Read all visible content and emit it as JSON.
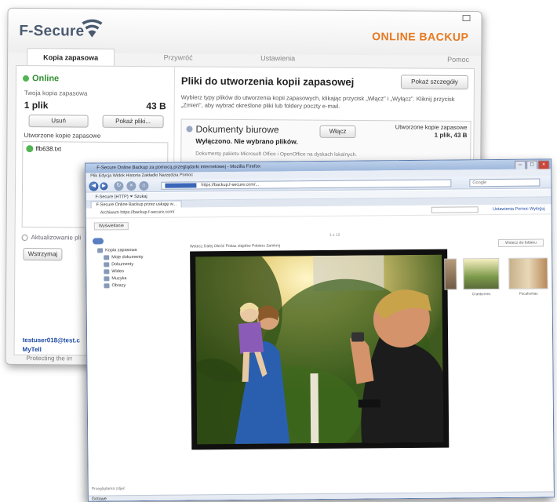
{
  "fsecure": {
    "brand": "F-Secure",
    "product": "ONLINE BACKUP",
    "tabs": [
      "Kopia zapasowa",
      "Przywróć",
      "Ustawienia"
    ],
    "help_label": "Pomoc",
    "left": {
      "status": "Online",
      "backups_label": "Twoja kopia zapasowa",
      "file_count": "1 plik",
      "file_size": "43 B",
      "delete_button": "Usuń",
      "show_files_button": "Pokaż pliki...",
      "created_label": "Utworzone kopie zapasowe",
      "file_name": "ffb638.txt",
      "update_label": "Aktualizowanie pli",
      "pause_button": "Wstrzymaj",
      "email": "testuser018@test.c",
      "account": "MyTell"
    },
    "right": {
      "title": "Pliki do utworzenia kopii zapasowej",
      "show_details_button": "Pokaż szczegóły",
      "description": "Wybierz typy plików do utworzenia kopii zapasowych, klikając przycisk „Włącz” i „Wyłącz”. Kliknij przycisk „Zmień”, aby wybrać określone pliki lub foldery poczty e-mail.",
      "docs_title": "Dokumenty biurowe",
      "enable_button": "Włącz",
      "docs_created_label": "Utworzone kopie zapasowe",
      "docs_created_value": "1 plik, 43 B",
      "docs_status": "Wyłączono. Nie wybrano plików.",
      "docs_note": "Dokumenty pakietu Microsoft Office i OpenOffice na dyskach lokalnych."
    },
    "footer": "Protecting the irr"
  },
  "browser": {
    "title": "F-Secure Online Backup za pomocą przeglądarki internetowej - Mozilla Firefox",
    "menu": "Plik   Edycja   Widok   Historia   Zakładki   Narzędzia   Pomoc",
    "url": "https://backup.f-secure.com/...",
    "search_placeholder": "Google",
    "bookmarks": "F-Secure (HTTP)   ⏷   Szukaj",
    "tab_label": "F-Secure Online Backup przez usługę w...",
    "page": {
      "toolbar": "Archiwum   https://backup.f-secure.com/",
      "toolbar_right": "Ustawienia   Pomoc   Wyloguj",
      "subtab": "Wyświetlanie",
      "tree": [
        "Kopia zapasowa",
        "Moje dokumenty",
        "Dokumenty",
        "Wideo",
        "Muzyka",
        "Obrazy"
      ],
      "photo_toolbar": "Wstecz   Dalej   Obróć   Pokaz slajdów   Pobierz   Zamknij",
      "crumb": "1 z 12",
      "right_button": "Wstecz do folderu",
      "thumb_labels": [
        "",
        "Cranberries",
        "Pocahontas"
      ],
      "status_line": "Przeglądarka zdjęć",
      "statusbar": "Gotowe"
    }
  }
}
